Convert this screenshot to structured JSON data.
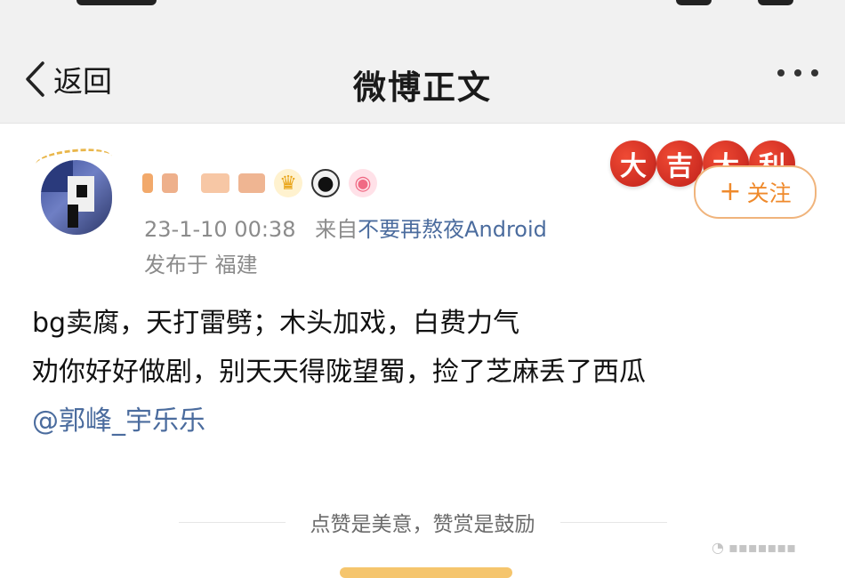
{
  "header": {
    "back_label": "返回",
    "title": "微博正文",
    "more_icon": "more-icon"
  },
  "post": {
    "author": {
      "badges": [
        "crown-icon",
        "panda-icon",
        "piggy-icon"
      ]
    },
    "timestamp": "23-1-10 00:38",
    "source_prefix": "来自",
    "source": "不要再熬夜Android",
    "location": "发布于 福建",
    "follow_label": "关注",
    "lucky_chars": [
      "大",
      "吉",
      "大",
      "利"
    ],
    "lines": [
      "bg卖腐，天打雷劈；木头加戏，白费力气",
      "劝你好好做剧，别天天得陇望蜀，捡了芝麻丢了西瓜"
    ],
    "mention": "@郭峰_宇乐乐"
  },
  "footer": {
    "slogan": "点赞是美意，赞赏是鼓励"
  },
  "colors": {
    "link": "#4b6c9e",
    "follow": "#ef8a2c",
    "lucky": "#c0201a"
  }
}
